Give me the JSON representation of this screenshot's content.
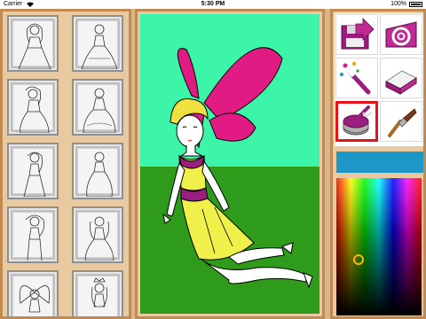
{
  "status_bar": {
    "carrier": "Carrier",
    "time": "5:30 PM",
    "battery": "100%"
  },
  "gallery": {
    "thumbnails": [
      {
        "label": "princess-1"
      },
      {
        "label": "princess-2"
      },
      {
        "label": "princess-3"
      },
      {
        "label": "princess-4"
      },
      {
        "label": "princess-5"
      },
      {
        "label": "princess-6"
      },
      {
        "label": "princess-7"
      },
      {
        "label": "princess-8"
      },
      {
        "label": "fairy-1"
      },
      {
        "label": "princess-9"
      }
    ]
  },
  "canvas": {
    "sky_color": "#3cf5a8",
    "grass_color": "#2f9b1a",
    "wing_color": "#e21a84",
    "dress_top_color": "#9a1e7e",
    "dress_skirt_color": "#f0f04a",
    "hair_color": "#f0e040"
  },
  "tools": {
    "items": [
      {
        "name": "save",
        "icon": "save-icon"
      },
      {
        "name": "email",
        "icon": "email-icon"
      },
      {
        "name": "magic-wand",
        "icon": "magic-wand-icon"
      },
      {
        "name": "eraser",
        "icon": "eraser-icon"
      },
      {
        "name": "paint-bucket",
        "icon": "paint-bucket-icon",
        "selected": true
      },
      {
        "name": "brush",
        "icon": "brush-icon"
      }
    ],
    "current_color": "#1d96c8"
  }
}
